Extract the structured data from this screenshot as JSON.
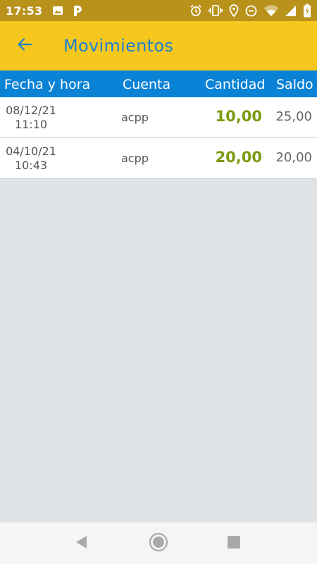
{
  "status_bar": {
    "time": "17:53",
    "left_icons": [
      "image-icon",
      "parking-icon"
    ],
    "right_icons": [
      "alarm-icon",
      "vibrate-icon",
      "location-icon",
      "dnd-icon",
      "wifi-icon",
      "signal-icon",
      "battery-charging-icon"
    ]
  },
  "app_bar": {
    "title": "Movimientos",
    "back_icon": "arrow-left-icon"
  },
  "table": {
    "headers": {
      "date": "Fecha y hora",
      "account": "Cuenta",
      "amount": "Cantidad",
      "balance": "Saldo"
    },
    "rows": [
      {
        "date": "08/12/21",
        "time": "11:10",
        "account": "acpp",
        "amount": "10,00",
        "balance": "25,00"
      },
      {
        "date": "04/10/21",
        "time": "10:43",
        "account": "acpp",
        "amount": "20,00",
        "balance": "20,00"
      }
    ]
  },
  "colors": {
    "status_bar": "#b8921a",
    "app_bar": "#f6c71d",
    "title": "#1c80d0",
    "header": "#0a82d6",
    "amount": "#7c9a11",
    "background": "#e0e3e6"
  },
  "nav_bar": {
    "buttons": [
      "back-triangle-icon",
      "home-circle-icon",
      "recents-square-icon"
    ]
  }
}
